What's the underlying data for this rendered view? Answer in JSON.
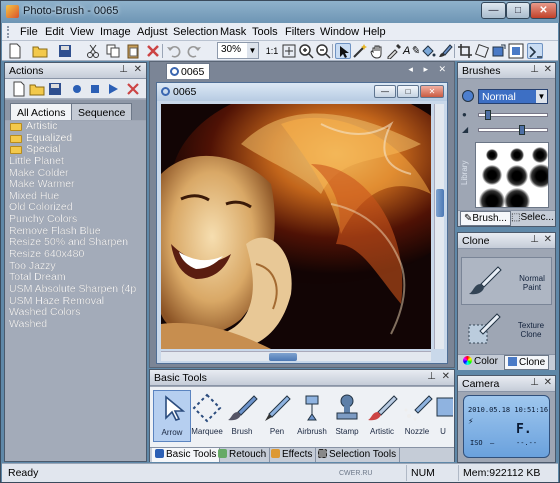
{
  "window": {
    "title": "Photo-Brush - 0065",
    "min_label": "—",
    "max_label": "□",
    "close_label": "✕"
  },
  "menu": [
    "File",
    "Edit",
    "View",
    "Image",
    "Adjust",
    "Selection",
    "Mask",
    "Tools",
    "Filters",
    "Window",
    "Help"
  ],
  "toolbar": {
    "zoom_value": "30%",
    "zoom_1to1": "1:1"
  },
  "actions_panel": {
    "title": "Actions",
    "tabs": [
      "All Actions",
      "Sequence"
    ],
    "folders": [
      "Artistic",
      "Equalized",
      "Special"
    ],
    "items": [
      "Little Planet",
      "Make Colder",
      "Make Warmer",
      "Mixed Hue",
      "Old Colorized",
      "Punchy Colors",
      "Remove Flash Blue",
      "Resize 50% and Sharpen",
      "Resize 640x480",
      "Too Jazzy",
      "Total Dream",
      "USM Absolute Sharpen (4p",
      "USM Haze Removal",
      "Washed Colors",
      "Washed"
    ]
  },
  "document": {
    "tab_label": "0065",
    "window_title": "0065",
    "tab_controls": "◂ ▸ ✕"
  },
  "basic_tools": {
    "title": "Basic Tools",
    "tools": [
      {
        "label": "Arrow",
        "icon": "arrow-icon"
      },
      {
        "label": "Marquee",
        "icon": "marquee-icon"
      },
      {
        "label": "Brush",
        "icon": "brush-icon"
      },
      {
        "label": "Pen",
        "icon": "pen-icon"
      },
      {
        "label": "Airbrush",
        "icon": "airbrush-icon"
      },
      {
        "label": "Stamp",
        "icon": "stamp-icon"
      },
      {
        "label": "Artistic",
        "icon": "artistic-brush-icon"
      },
      {
        "label": "Nozzle",
        "icon": "nozzle-icon"
      },
      {
        "label": "U",
        "icon": "tool-icon"
      }
    ],
    "tabs": [
      "Basic Tools",
      "Retouch",
      "Effects",
      "Selection Tools"
    ]
  },
  "brushes_panel": {
    "title": "Brushes",
    "mode": "Normal",
    "vertical_label": "Library",
    "tabs": [
      "Brush...",
      "Selec..."
    ]
  },
  "clone_panel": {
    "title": "Clone",
    "options": [
      {
        "label": "Normal Paint",
        "icon": "normal-paint-icon"
      },
      {
        "label": "Texture Clone",
        "icon": "texture-clone-icon"
      }
    ],
    "tabs": [
      "Color",
      "Clone"
    ]
  },
  "camera_panel": {
    "title": "Camera",
    "date": "2010.05.18 10:51:16",
    "flash": "⚡",
    "mode": "F.",
    "iso": "ISO",
    "iso_value": "–",
    "exposure": "--.--"
  },
  "statusbar": {
    "ready": "Ready",
    "site": "CWER.RU",
    "num": "NUM",
    "mem": "Mem:922112 KB"
  },
  "colors": {
    "accent": "#3d6fc4",
    "panel_bg": "#9ea6b4",
    "title_bar": "#7fa3c0"
  }
}
